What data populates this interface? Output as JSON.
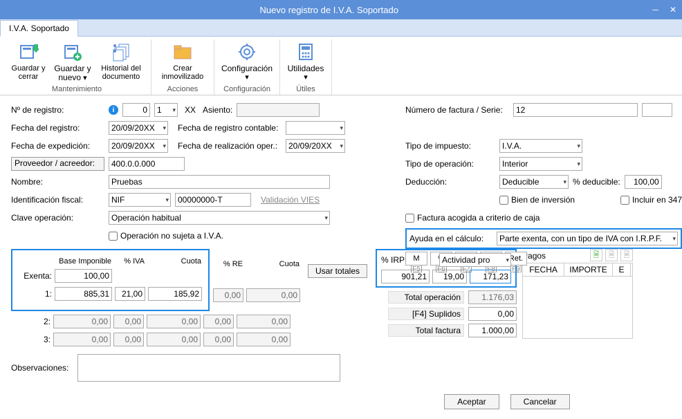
{
  "window": {
    "title": "Nuevo registro de I.V.A. Soportado",
    "tab": "I.V.A. Soportado"
  },
  "ribbon": {
    "mantenimiento": {
      "label": "Mantenimiento",
      "guardar_cerrar": "Guardar y cerrar",
      "guardar_nuevo": "Guardar y nuevo",
      "historial": "Historial del documento"
    },
    "acciones": {
      "label": "Acciones",
      "crear": "Crear inmovilizado"
    },
    "configuracion": {
      "label": "Configuración",
      "btn": "Configuración"
    },
    "utiles": {
      "label": "Útiles",
      "btn": "Utilidades"
    }
  },
  "left": {
    "num_registro_label": "Nº de registro:",
    "num_registro_val": "0",
    "num_registro_seq": "1",
    "xx": "XX",
    "asiento_label": "Asiento:",
    "asiento_val": "",
    "fecha_registro_label": "Fecha del registro:",
    "fecha_registro_val": "20/09/20XX",
    "fecha_reg_contable_label": "Fecha de registro contable:",
    "fecha_reg_contable_val": "",
    "fecha_expedicion_label": "Fecha de expedición:",
    "fecha_expedicion_val": "20/09/20XX",
    "fecha_realizacion_label": "Fecha de realización oper.:",
    "fecha_realizacion_val": "20/09/20XX",
    "proveedor_label": "Proveedor / acreedor:",
    "proveedor_val": "400.0.0.000",
    "nombre_label": "Nombre:",
    "nombre_val": "Pruebas",
    "id_fiscal_label": "Identificación fiscal:",
    "id_fiscal_tipo": "NIF",
    "id_fiscal_val": "00000000-T",
    "validacion_vies": "Validación VIES",
    "clave_op_label": "Clave operación:",
    "clave_op_val": "Operación habitual",
    "op_no_sujeta": "Operación no sujeta a I.V.A."
  },
  "right": {
    "num_factura_label": "Número de factura / Serie:",
    "num_factura_val": "12",
    "serie_val": "",
    "tipo_impuesto_label": "Tipo de impuesto:",
    "tipo_impuesto_val": "I.V.A.",
    "tipo_operacion_label": "Tipo de operación:",
    "tipo_operacion_val": "Interior",
    "deduccion_label": "Deducción:",
    "deduccion_val": "Deducible",
    "pct_deducible_label": "% deducible:",
    "pct_deducible_val": "100,00",
    "bien_inversion": "Bien de inversión",
    "incluir_347": "Incluir en 347",
    "factura_caja": "Factura acogida a criterio de caja",
    "ayuda_label": "Ayuda en el cálculo:",
    "ayuda_val": "Parte exenta, con un tipo de IVA con I.R.P.F.",
    "rates": {
      "M": "M",
      "pct": "%",
      "pctpct": "%%",
      "zero": "0%",
      "ret": "Ret."
    },
    "fkeys": {
      "f5": "[F5]",
      "f6": "[F6]",
      "f7": "[F7]",
      "f8": "[F8]",
      "f9": "[F9]"
    }
  },
  "bases": {
    "headers": {
      "base": "Base Imponible",
      "iva": "% IVA",
      "cuota": "Cuota",
      "re": "% RE",
      "cuota_re": "Cuota"
    },
    "exenta_label": "Exenta:",
    "exenta_base": "100,00",
    "r1_label": "1:",
    "r1_base": "885,31",
    "r1_iva": "21,00",
    "r1_cuota": "185,92",
    "r1_re": "0,00",
    "r1_cuota_re": "0,00",
    "r2_label": "2:",
    "r2_base": "0,00",
    "r2_iva": "0,00",
    "r2_cuota": "0,00",
    "r2_re": "0,00",
    "r2_cuota_re": "0,00",
    "r3_label": "3:",
    "r3_base": "0,00",
    "r3_iva": "0,00",
    "r3_cuota": "0,00",
    "r3_re": "0,00",
    "r3_cuota_re": "0,00",
    "usar_totales": "Usar totales"
  },
  "irpf": {
    "pct_label": "% IRPF",
    "actividad": "Actividad pro",
    "base": "901,21",
    "pct": "19,00",
    "cuota": "171,23"
  },
  "totales": {
    "op_label": "Total operación",
    "op_val": "1.176,03",
    "sup_label": "[F4] Suplidos",
    "sup_val": "0,00",
    "fac_label": "Total factura",
    "fac_val": "1.000,00"
  },
  "pagos": {
    "title": "Pagos",
    "col_fecha": "FECHA",
    "col_importe": "IMPORTE",
    "col_e": "E"
  },
  "obs": {
    "label": "Observaciones:",
    "val": ""
  },
  "footer": {
    "aceptar": "Aceptar",
    "cancelar": "Cancelar"
  }
}
